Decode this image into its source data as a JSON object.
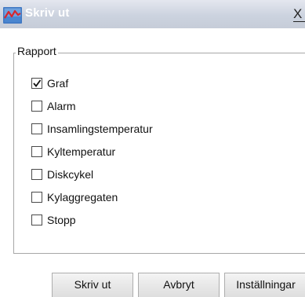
{
  "window": {
    "title": "Skriv ut",
    "close_label": "X",
    "icon": "chart-line-app-icon"
  },
  "group": {
    "legend": "Rapport",
    "items": [
      {
        "label": "Graf",
        "checked": true
      },
      {
        "label": "Alarm",
        "checked": false
      },
      {
        "label": "Insamlingstemperatur",
        "checked": false
      },
      {
        "label": "Kyltemperatur",
        "checked": false
      },
      {
        "label": "Diskcykel",
        "checked": false
      },
      {
        "label": "Kylaggregaten",
        "checked": false
      },
      {
        "label": "Stopp",
        "checked": false
      }
    ]
  },
  "buttons": {
    "print": "Skriv ut",
    "cancel": "Avbryt",
    "settings": "Inställningar"
  },
  "colors": {
    "title_text": "#ffffff",
    "titlebar": "#ccd3df",
    "icon_line": "#d8262d",
    "icon_bg": "#4a7fc4"
  }
}
